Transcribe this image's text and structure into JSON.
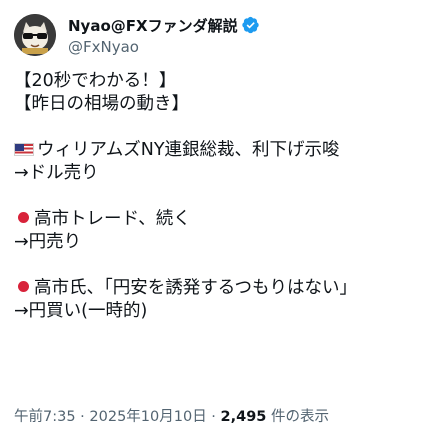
{
  "author": {
    "display_name": "Nyao@FXファンダ解説",
    "handle": "@FxNyao",
    "verified_icon": "verified-badge-icon",
    "avatar_icon": "cat-sunglasses-avatar-icon"
  },
  "tweet": {
    "line1": "【20秒でわかる！】",
    "line2": "【昨日の相場の動き】",
    "line3_text": "ウィリアムズNY連銀総裁、利下げ示唆",
    "line3_icon": "us-flag-icon",
    "line4": "→ドル売り",
    "line5_text": "高市トレード、続く",
    "line5_icon": "red-circle-icon",
    "line6": "→円売り",
    "line7_text": "高市氏、「円安を誘発するつもりはない」",
    "line7_icon": "red-circle-icon",
    "line8": "→円買い(一時的)"
  },
  "meta": {
    "time": "午前7:35",
    "separator1": " · ",
    "date": "2025年10月10日",
    "separator2": " · ",
    "views_count": "2,495",
    "views_label": " 件の表示"
  },
  "colors": {
    "text": "#0f1419",
    "muted": "#536471",
    "verified": "#1d9bf0",
    "red_circle": "#d8223a"
  }
}
